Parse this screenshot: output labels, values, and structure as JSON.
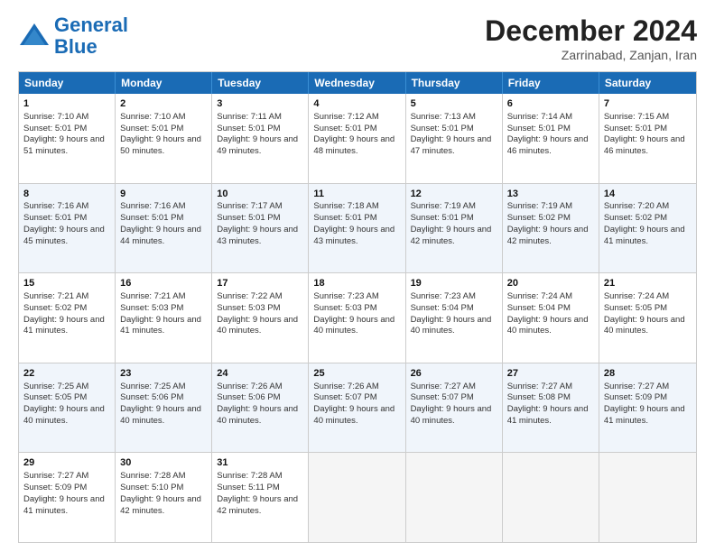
{
  "header": {
    "logo_line1": "General",
    "logo_line2": "Blue",
    "title": "December 2024",
    "subtitle": "Zarrinabad, Zanjan, Iran"
  },
  "weekdays": [
    "Sunday",
    "Monday",
    "Tuesday",
    "Wednesday",
    "Thursday",
    "Friday",
    "Saturday"
  ],
  "rows": [
    [
      {
        "day": 1,
        "sunrise": "7:10 AM",
        "sunset": "5:01 PM",
        "daylight": "9 hours and 51 minutes."
      },
      {
        "day": 2,
        "sunrise": "7:10 AM",
        "sunset": "5:01 PM",
        "daylight": "9 hours and 50 minutes."
      },
      {
        "day": 3,
        "sunrise": "7:11 AM",
        "sunset": "5:01 PM",
        "daylight": "9 hours and 49 minutes."
      },
      {
        "day": 4,
        "sunrise": "7:12 AM",
        "sunset": "5:01 PM",
        "daylight": "9 hours and 48 minutes."
      },
      {
        "day": 5,
        "sunrise": "7:13 AM",
        "sunset": "5:01 PM",
        "daylight": "9 hours and 47 minutes."
      },
      {
        "day": 6,
        "sunrise": "7:14 AM",
        "sunset": "5:01 PM",
        "daylight": "9 hours and 46 minutes."
      },
      {
        "day": 7,
        "sunrise": "7:15 AM",
        "sunset": "5:01 PM",
        "daylight": "9 hours and 46 minutes."
      }
    ],
    [
      {
        "day": 8,
        "sunrise": "7:16 AM",
        "sunset": "5:01 PM",
        "daylight": "9 hours and 45 minutes."
      },
      {
        "day": 9,
        "sunrise": "7:16 AM",
        "sunset": "5:01 PM",
        "daylight": "9 hours and 44 minutes."
      },
      {
        "day": 10,
        "sunrise": "7:17 AM",
        "sunset": "5:01 PM",
        "daylight": "9 hours and 43 minutes."
      },
      {
        "day": 11,
        "sunrise": "7:18 AM",
        "sunset": "5:01 PM",
        "daylight": "9 hours and 43 minutes."
      },
      {
        "day": 12,
        "sunrise": "7:19 AM",
        "sunset": "5:01 PM",
        "daylight": "9 hours and 42 minutes."
      },
      {
        "day": 13,
        "sunrise": "7:19 AM",
        "sunset": "5:02 PM",
        "daylight": "9 hours and 42 minutes."
      },
      {
        "day": 14,
        "sunrise": "7:20 AM",
        "sunset": "5:02 PM",
        "daylight": "9 hours and 41 minutes."
      }
    ],
    [
      {
        "day": 15,
        "sunrise": "7:21 AM",
        "sunset": "5:02 PM",
        "daylight": "9 hours and 41 minutes."
      },
      {
        "day": 16,
        "sunrise": "7:21 AM",
        "sunset": "5:03 PM",
        "daylight": "9 hours and 41 minutes."
      },
      {
        "day": 17,
        "sunrise": "7:22 AM",
        "sunset": "5:03 PM",
        "daylight": "9 hours and 40 minutes."
      },
      {
        "day": 18,
        "sunrise": "7:23 AM",
        "sunset": "5:03 PM",
        "daylight": "9 hours and 40 minutes."
      },
      {
        "day": 19,
        "sunrise": "7:23 AM",
        "sunset": "5:04 PM",
        "daylight": "9 hours and 40 minutes."
      },
      {
        "day": 20,
        "sunrise": "7:24 AM",
        "sunset": "5:04 PM",
        "daylight": "9 hours and 40 minutes."
      },
      {
        "day": 21,
        "sunrise": "7:24 AM",
        "sunset": "5:05 PM",
        "daylight": "9 hours and 40 minutes."
      }
    ],
    [
      {
        "day": 22,
        "sunrise": "7:25 AM",
        "sunset": "5:05 PM",
        "daylight": "9 hours and 40 minutes."
      },
      {
        "day": 23,
        "sunrise": "7:25 AM",
        "sunset": "5:06 PM",
        "daylight": "9 hours and 40 minutes."
      },
      {
        "day": 24,
        "sunrise": "7:26 AM",
        "sunset": "5:06 PM",
        "daylight": "9 hours and 40 minutes."
      },
      {
        "day": 25,
        "sunrise": "7:26 AM",
        "sunset": "5:07 PM",
        "daylight": "9 hours and 40 minutes."
      },
      {
        "day": 26,
        "sunrise": "7:27 AM",
        "sunset": "5:07 PM",
        "daylight": "9 hours and 40 minutes."
      },
      {
        "day": 27,
        "sunrise": "7:27 AM",
        "sunset": "5:08 PM",
        "daylight": "9 hours and 41 minutes."
      },
      {
        "day": 28,
        "sunrise": "7:27 AM",
        "sunset": "5:09 PM",
        "daylight": "9 hours and 41 minutes."
      }
    ],
    [
      {
        "day": 29,
        "sunrise": "7:27 AM",
        "sunset": "5:09 PM",
        "daylight": "9 hours and 41 minutes."
      },
      {
        "day": 30,
        "sunrise": "7:28 AM",
        "sunset": "5:10 PM",
        "daylight": "9 hours and 42 minutes."
      },
      {
        "day": 31,
        "sunrise": "7:28 AM",
        "sunset": "5:11 PM",
        "daylight": "9 hours and 42 minutes."
      },
      null,
      null,
      null,
      null
    ]
  ]
}
